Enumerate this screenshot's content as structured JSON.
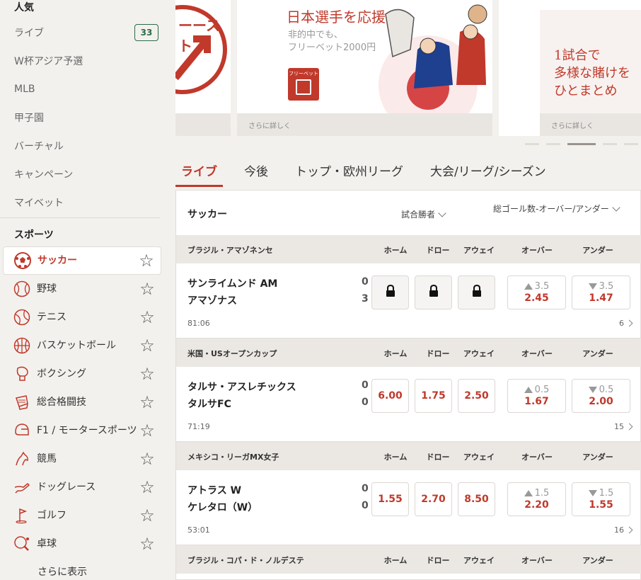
{
  "sidebar": {
    "popular_title": "人気",
    "popular": [
      {
        "label": "ライブ",
        "badge": "33"
      },
      {
        "label": "W杯アジア予選"
      },
      {
        "label": "MLB"
      },
      {
        "label": "甲子園"
      },
      {
        "label": "バーチャル"
      },
      {
        "label": "キャンペーン"
      },
      {
        "label": "マイベット"
      }
    ],
    "sports_title": "スポーツ",
    "sports": [
      {
        "label": "サッカー",
        "icon": "soccer-ball-icon"
      },
      {
        "label": "野球",
        "icon": "baseball-icon"
      },
      {
        "label": "テニス",
        "icon": "tennis-ball-icon"
      },
      {
        "label": "バスケットボール",
        "icon": "basketball-icon"
      },
      {
        "label": "ボクシング",
        "icon": "boxing-glove-icon"
      },
      {
        "label": "総合格闘技",
        "icon": "mma-glove-icon"
      },
      {
        "label": "F1 / モータースポーツ",
        "icon": "helmet-icon"
      },
      {
        "label": "競馬",
        "icon": "horse-icon"
      },
      {
        "label": "ドッグレース",
        "icon": "greyhound-icon"
      },
      {
        "label": "ゴルフ",
        "icon": "golf-flag-icon"
      },
      {
        "label": "卓球",
        "icon": "table-tennis-icon"
      }
    ],
    "show_more": "さらに表示"
  },
  "banners": [
    {
      "headline": "ーースト",
      "footer": ""
    },
    {
      "headline": "日本選手を応援",
      "sub1": "非的中でも、",
      "sub2": "フリーベット2000円",
      "tag": "フリーベット",
      "footer": "さらに詳しく"
    },
    {
      "line1": "1試合で",
      "line2": "多様な賭けを",
      "line3": "ひとまとめ",
      "footer": "さらに詳しく"
    }
  ],
  "tabs": [
    "ライブ",
    "今後",
    "トップ・欧州リーグ",
    "大会/リーグ/シーズン"
  ],
  "panel": {
    "sport": "サッカー",
    "market1": "試合勝者",
    "market2": "総ゴール数-オーバー/アンダー",
    "headers": {
      "home": "ホーム",
      "draw": "ドロー",
      "away": "アウェイ",
      "over": "オーバー",
      "under": "アンダー"
    },
    "leagues": [
      {
        "name": "ブラジル・アマゾネンセ",
        "match": {
          "home": "サンライムンド AM",
          "away": "アマゾナス",
          "home_score": "0",
          "away_score": "3",
          "time": "81:06",
          "markets": "6",
          "odds": [
            "",
            "",
            ""
          ],
          "locked": true,
          "over_line": "3.5",
          "over": "2.45",
          "under_line": "3.5",
          "under": "1.47"
        }
      },
      {
        "name": "米国・USオープンカップ",
        "match": {
          "home": "タルサ・アスレチックス",
          "away": "タルサFC",
          "home_score": "0",
          "away_score": "0",
          "time": "71:19",
          "markets": "15",
          "odds": [
            "6.00",
            "1.75",
            "2.50"
          ],
          "locked": false,
          "over_line": "0.5",
          "over": "1.67",
          "under_line": "0.5",
          "under": "2.00"
        }
      },
      {
        "name": "メキシコ・リーガMX女子",
        "match": {
          "home": "アトラス W",
          "away": "ケレタロ（W）",
          "home_score": "0",
          "away_score": "0",
          "time": "53:01",
          "markets": "16",
          "odds": [
            "1.55",
            "2.70",
            "8.50"
          ],
          "locked": false,
          "over_line": "1.5",
          "over": "2.20",
          "under_line": "1.5",
          "under": "1.55"
        }
      },
      {
        "name": "ブラジル・コパ・ド・ノルデステ"
      }
    ]
  },
  "colors": {
    "accent": "#c0392b",
    "badge": "#2e6b45"
  }
}
